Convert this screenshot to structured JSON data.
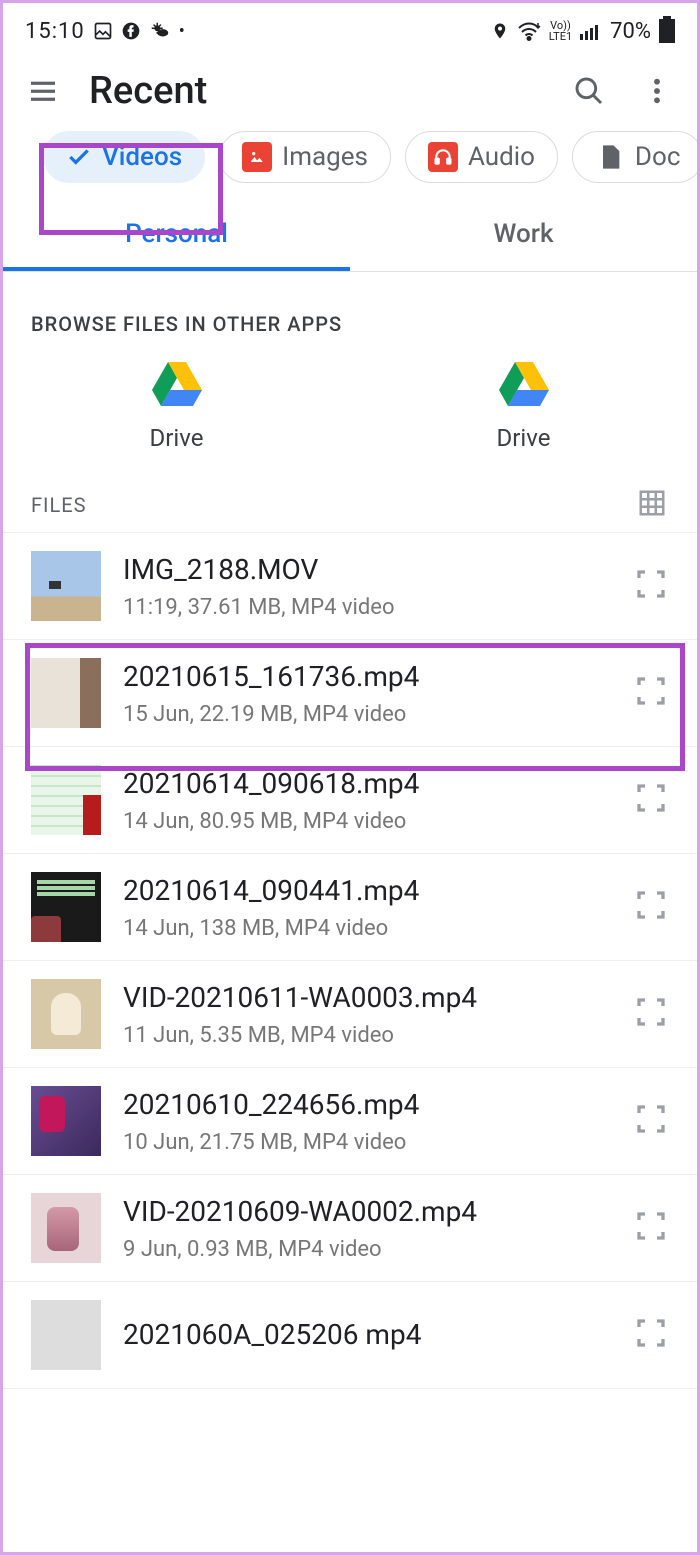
{
  "status": {
    "time": "15:10",
    "battery": "70%",
    "network_label": "Vo))\nLTE1"
  },
  "appbar": {
    "title": "Recent"
  },
  "chips": [
    {
      "label": "Videos",
      "selected": true,
      "icon": "check"
    },
    {
      "label": "Images",
      "selected": false,
      "icon": "image"
    },
    {
      "label": "Audio",
      "selected": false,
      "icon": "audio"
    },
    {
      "label": "Doc",
      "selected": false,
      "icon": "doc"
    }
  ],
  "tabs": [
    {
      "label": "Personal",
      "active": true
    },
    {
      "label": "Work",
      "active": false
    }
  ],
  "browse_section": {
    "title": "BROWSE FILES IN OTHER APPS",
    "apps": [
      {
        "label": "Drive"
      },
      {
        "label": "Drive"
      }
    ]
  },
  "files_section": {
    "title": "FILES"
  },
  "files": [
    {
      "name": "IMG_2188.MOV",
      "meta": "11:19, 37.61 MB, MP4 video",
      "thumb": "thumb-sky"
    },
    {
      "name": "20210615_161736.mp4",
      "meta": "15 Jun, 22.19 MB, MP4 video",
      "thumb": "thumb-room"
    },
    {
      "name": "20210614_090618.mp4",
      "meta": "14 Jun, 80.95 MB, MP4 video",
      "thumb": "thumb-greenlines"
    },
    {
      "name": "20210614_090441.mp4",
      "meta": "14 Jun, 138 MB, MP4 video",
      "thumb": "thumb-dark"
    },
    {
      "name": "VID-20210611-WA0003.mp4",
      "meta": "11 Jun, 5.35 MB, MP4 video",
      "thumb": "thumb-statue"
    },
    {
      "name": "20210610_224656.mp4",
      "meta": "10 Jun, 21.75 MB, MP4 video",
      "thumb": "thumb-purple"
    },
    {
      "name": "VID-20210609-WA0002.mp4",
      "meta": "9 Jun, 0.93 MB, MP4 video",
      "thumb": "thumb-pink"
    },
    {
      "name": "2021060A_025206 mp4",
      "meta": "",
      "thumb": ""
    }
  ]
}
